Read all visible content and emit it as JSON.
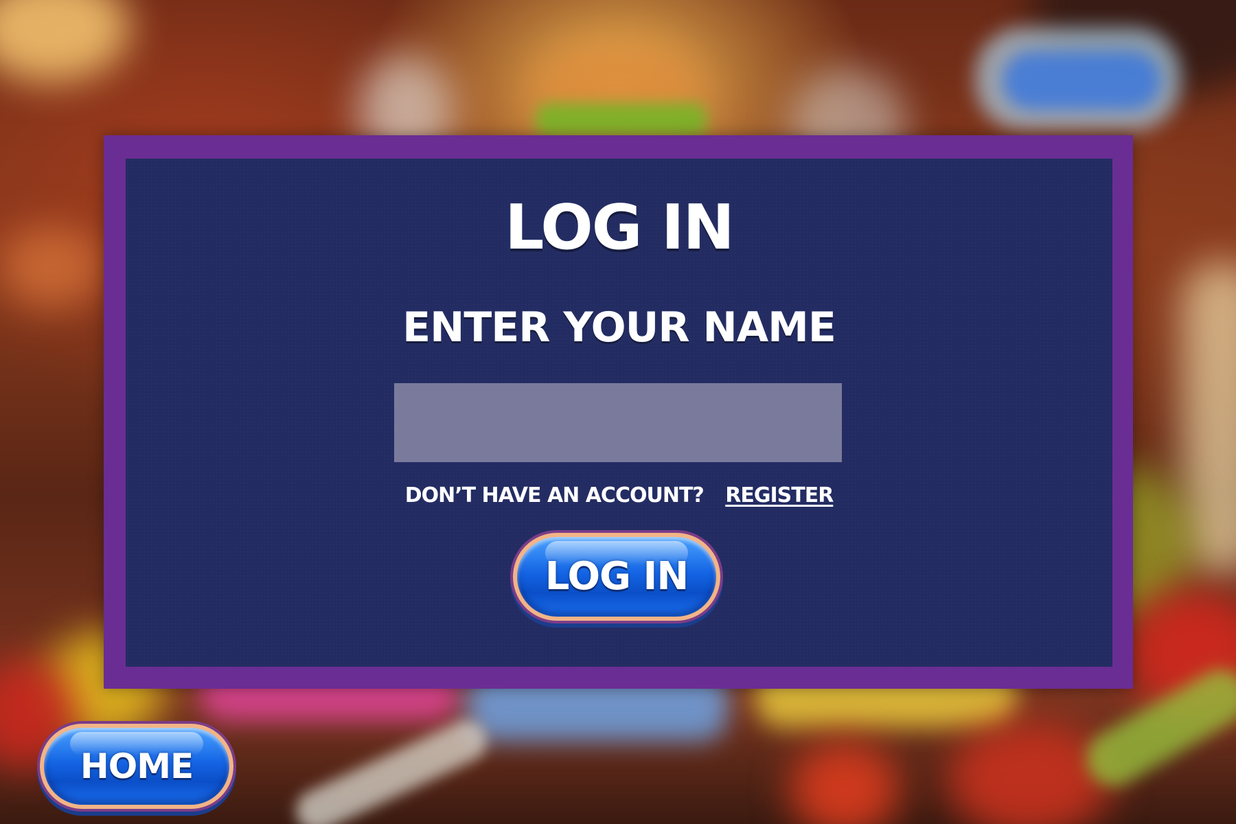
{
  "dialog": {
    "title": "LOG IN",
    "name_label": "ENTER YOUR NAME",
    "name_input": {
      "value": "",
      "placeholder": ""
    },
    "account_prompt": "DON’T HAVE AN ACCOUNT?",
    "register_label": "REGISTER",
    "login_button": "LOG IN"
  },
  "home_button": "HOME",
  "colors": {
    "frame": "#6a2d94",
    "panel": "#232c62",
    "input": "#7a7b9c",
    "button": "#1464e4",
    "text": "#ffffff"
  }
}
